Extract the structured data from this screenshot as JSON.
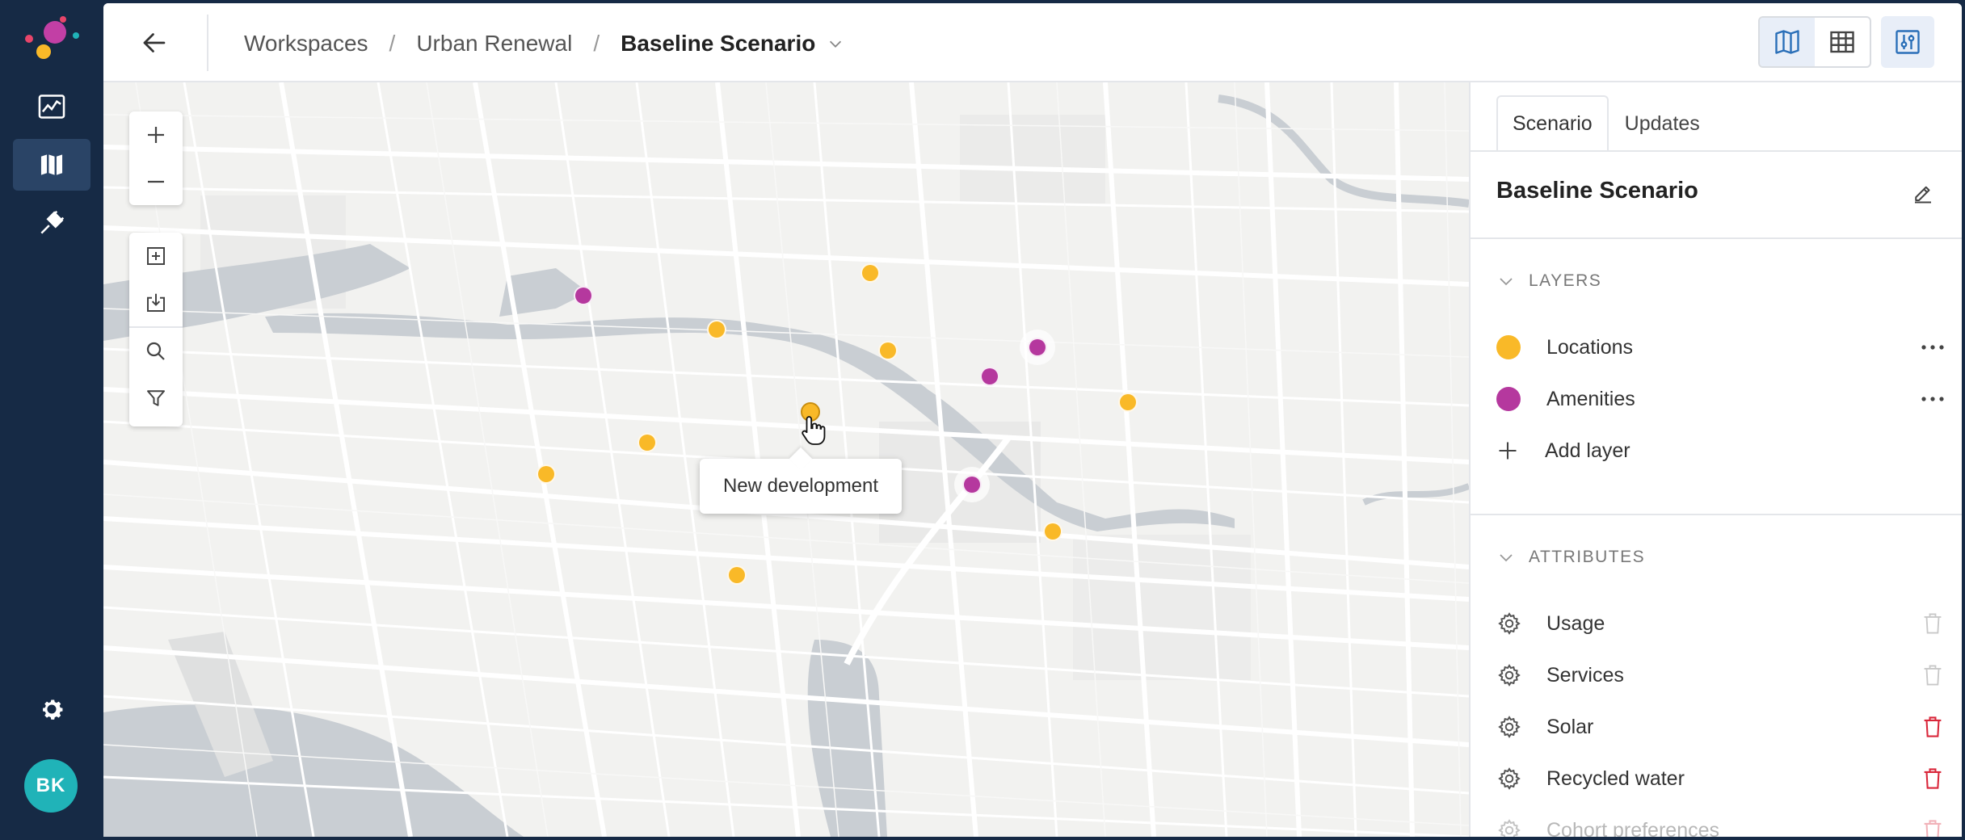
{
  "rail": {
    "avatar_initials": "BK",
    "items": [
      {
        "icon": "trend-chart-icon",
        "active": false
      },
      {
        "icon": "map-icon",
        "active": true
      },
      {
        "icon": "plug-icon",
        "active": false
      }
    ],
    "settings_icon": "gear-icon"
  },
  "header": {
    "breadcrumbs": [
      "Workspaces",
      "Urban Renewal"
    ],
    "separator": "/",
    "current": "Baseline Scenario",
    "view_modes": [
      "map-view-icon",
      "table-view-icon"
    ],
    "active_view": "map"
  },
  "map": {
    "tooltip": "New development",
    "marker_colors": {
      "locations": "#f9b928",
      "amenities": "#b5389e"
    },
    "tools": [
      "zoom-in-icon",
      "zoom-out-icon",
      "add-area-icon",
      "import-icon",
      "search-icon",
      "filter-icon"
    ]
  },
  "panel": {
    "tabs": [
      {
        "label": "Scenario",
        "active": true
      },
      {
        "label": "Updates",
        "active": false
      }
    ],
    "title": "Baseline Scenario",
    "layers_heading": "LAYERS",
    "layers": [
      {
        "name": "Locations",
        "color": "#f9b928"
      },
      {
        "name": "Amenities",
        "color": "#b5389e"
      }
    ],
    "add_layer": "Add layer",
    "attributes_heading": "ATTRIBUTES",
    "attributes": [
      {
        "name": "Usage",
        "deletable": false
      },
      {
        "name": "Services",
        "deletable": false
      },
      {
        "name": "Solar",
        "deletable": true
      },
      {
        "name": "Recycled water",
        "deletable": true
      },
      {
        "name": "Cohort preferences",
        "deletable": true
      }
    ]
  },
  "colors": {
    "rail_bg": "#162a45",
    "accent_blue": "#2a6fb8",
    "danger_red": "#d9263a",
    "avatar_teal": "#20b3b8"
  }
}
